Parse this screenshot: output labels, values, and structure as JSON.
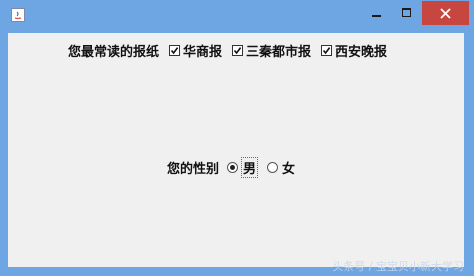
{
  "window": {
    "controls": {
      "minimize": "minimize-icon",
      "maximize": "maximize-icon",
      "close": "close-icon"
    },
    "colors": {
      "frame": "#6ea6e3",
      "client": "#f0f0f0",
      "close": "#c7463f"
    }
  },
  "newspapers": {
    "label": "您最常读的报纸",
    "options": [
      {
        "label": "华商报",
        "checked": true
      },
      {
        "label": "三秦都市报",
        "checked": true
      },
      {
        "label": "西安晚报",
        "checked": true
      }
    ]
  },
  "gender": {
    "label": "您的性别",
    "options": [
      {
        "label": "男",
        "selected": true
      },
      {
        "label": "女",
        "selected": false
      }
    ]
  },
  "watermark": "头条号 / 宝宝贝小新大学习"
}
